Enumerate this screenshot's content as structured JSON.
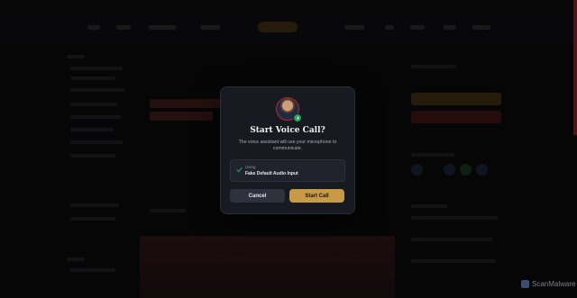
{
  "modal": {
    "title": "Start Voice Call?",
    "description": "The voice assistant will use your microphone to communicate.",
    "device": {
      "label": "Using",
      "name": "Fake Default Audio Input"
    },
    "cancel_label": "Cancel",
    "start_label": "Start Call"
  },
  "watermark": {
    "text": "ScanMalware"
  },
  "colors": {
    "accent": "#c99a45",
    "badge": "#22a35a",
    "modal_bg": "#181a21",
    "check": "#22a35a"
  },
  "icons": {
    "avatar": "avatar-image",
    "badge": "microphone-icon",
    "device": "check-icon",
    "watermark": "scanmalware-logo-icon"
  }
}
